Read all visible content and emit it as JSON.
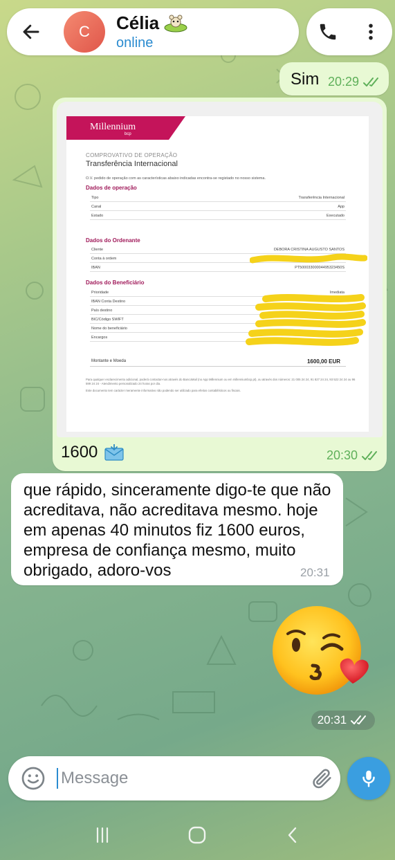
{
  "header": {
    "contact_name": "Célia",
    "contact_status": "online",
    "avatar_letter": "C",
    "avatar_color": "#e96a5b"
  },
  "messages": {
    "sim": {
      "text": "Sim",
      "time": "20:29"
    },
    "photo": {
      "caption": "1600",
      "time": "20:30"
    },
    "reply": {
      "text": "que rápido, sinceramente digo-te que não acreditava, não acreditava mesmo. hoje em apenas 40 minutos fiz 1600 euros, empresa de confiança mesmo, muito obrigado, adoro-vos",
      "time": "20:31"
    },
    "sticker": {
      "time": "20:31"
    }
  },
  "document": {
    "logo": "Millennium",
    "logo_sub": "bcp",
    "kicker": "COMPROVATIVO DE OPERAÇÃO",
    "title": "Transferência Internacional",
    "intro": "O.V. pedido de operação com as características abaixo indicadas encontra-se registado no nosso sistema.",
    "section_operacao": "Dados de operação",
    "rows_operacao": [
      {
        "k": "Tipo",
        "v": "Transferência Internacional"
      },
      {
        "k": "Canal",
        "v": "App"
      },
      {
        "k": "Estado",
        "v": "Executado"
      }
    ],
    "section_ordenante": "Dados do Ordenante",
    "rows_ordenante": [
      {
        "k": "Cliente",
        "v": "DEBORA CRISTINA AUGUSTO SANTOS"
      },
      {
        "k": "Conta à ordem",
        "v": ""
      },
      {
        "k": "IBAN",
        "v": "PT50003300004495323450S"
      }
    ],
    "section_beneficiario": "Dados do Beneficiário",
    "rows_beneficiario": [
      {
        "k": "Prioridade",
        "v": "Imediata"
      },
      {
        "k": "IBAN Conta Destino",
        "v": ""
      },
      {
        "k": "País destino",
        "v": ""
      },
      {
        "k": "BIC/Código SWIFT",
        "v": ""
      },
      {
        "k": "Nome do beneficiário",
        "v": ""
      },
      {
        "k": "Encargos",
        "v": ""
      }
    ],
    "amount_label": "Montante e Moeda",
    "amount_value": "1600,00 EUR",
    "footer_1": "Para qualquer esclarecimento adicional, poderá contactar-nos através do BancoMail (no App Millennium ou em millenniumbcp.pt), ou através dos números: 21 005 24 24, 91 827 24 24, 93 522 24 24 ou 96 599 24 24 - Atendimento personalizado 24 horas por dia.",
    "footer_2": "Este documento tem carácter meramente informativo não podendo ser utilizado para efeitos contabilísticos ou fiscais."
  },
  "composer": {
    "placeholder": "Message"
  },
  "colors": {
    "accent": "#3a9ee0",
    "outgoing_bubble": "#e8f9d4",
    "bank_brand": "#c4145a"
  },
  "icons": {
    "back": "arrow-left-icon",
    "call": "phone-icon",
    "menu": "more-vertical-icon",
    "emoji": "smiley-icon",
    "attach": "paperclip-icon",
    "mic": "microphone-icon"
  }
}
